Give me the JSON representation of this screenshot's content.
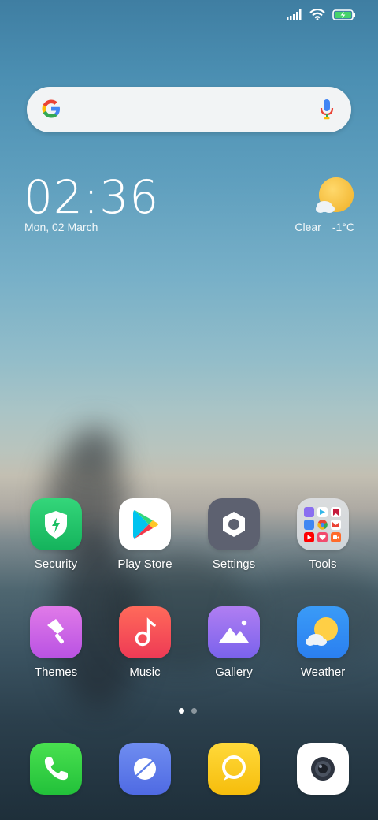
{
  "status_bar": {
    "signal_icon": "signal-icon",
    "wifi_icon": "wifi-icon",
    "battery_icon": "battery-charging-icon"
  },
  "search": {
    "logo_icon": "google-g-icon",
    "mic_icon": "microphone-icon"
  },
  "clock": {
    "time": "02:36",
    "date": "Mon, 02 March"
  },
  "weather_widget": {
    "condition": "Clear",
    "temperature": "-1°C",
    "icon": "sun-cloud-icon"
  },
  "apps": [
    {
      "label": "Security",
      "icon": "shield-bolt-icon"
    },
    {
      "label": "Play Store",
      "icon": "play-store-icon"
    },
    {
      "label": "Settings",
      "icon": "gear-icon"
    },
    {
      "label": "Tools",
      "icon": "folder-icon"
    },
    {
      "label": "Themes",
      "icon": "paint-brush-icon"
    },
    {
      "label": "Music",
      "icon": "music-note-icon"
    },
    {
      "label": "Gallery",
      "icon": "mountain-photo-icon"
    },
    {
      "label": "Weather",
      "icon": "sun-cloud-icon"
    }
  ],
  "page_indicator": {
    "total_pages": 2,
    "current_page": 1
  },
  "dock": [
    {
      "icon": "phone-icon"
    },
    {
      "icon": "messaging-icon"
    },
    {
      "icon": "chat-bubble-icon"
    },
    {
      "icon": "camera-icon"
    }
  ],
  "colors": {
    "security": "#22c36b",
    "settings": "#5d6170",
    "themes": "#d25ee6",
    "music": "#f24b52",
    "gallery": "#8a6ef0",
    "weather": "#2f8df5",
    "phone": "#2ecc40",
    "messaging": "#5c7de8",
    "chat": "#f7c81a",
    "camera": "#ffffff"
  }
}
